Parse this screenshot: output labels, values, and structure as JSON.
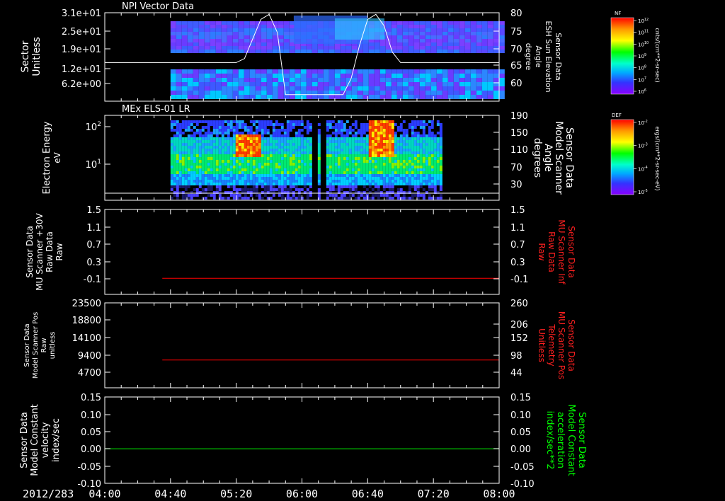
{
  "chart_data": [
    {
      "type": "heatmap",
      "title": "NPI Vector Data",
      "ylabel_left": [
        "Sector",
        "Unitless"
      ],
      "ylabel_right": [
        "Sensor Data",
        "ESH Sun Elevation",
        "Angle",
        "degree"
      ],
      "yticks_left": [
        "3.1e+01",
        "2.5e+01",
        "1.9e+01",
        "1.2e+01",
        "6.2e+00"
      ],
      "yticks_right": [
        "80",
        "75",
        "70",
        "65",
        "60"
      ],
      "ylim_right": [
        53,
        80
      ],
      "colorbar": {
        "label": "NF",
        "units": "cnts/(cm**2-sr-sec)",
        "ticks": [
          "10^12",
          "10^11",
          "10^10",
          "10^9",
          "10^8",
          "10^7",
          "10^6"
        ]
      },
      "overlay_line": {
        "name": "ESH Sun Elevation Angle",
        "color": "#ffffff",
        "x": [
          "04:00",
          "05:20",
          "05:25",
          "05:30",
          "05:35",
          "05:40",
          "05:45",
          "05:50",
          "06:25",
          "06:30",
          "06:35",
          "06:40",
          "06:45",
          "06:50",
          "06:55",
          "07:00",
          "08:00"
        ],
        "y": [
          64.8,
          64.8,
          66,
          72,
          78,
          79.5,
          74,
          55,
          55,
          60,
          70,
          78,
          79.5,
          76,
          68,
          64.8,
          64.8
        ]
      }
    },
    {
      "type": "heatmap",
      "title": "MEx ELS-01 LR",
      "ylabel_left": [
        "Electron Energy",
        "eV"
      ],
      "ylabel_right": [
        "Sensor Data",
        "Model Scanner",
        "Angle",
        "degrees"
      ],
      "yticks_left": [
        "10^2",
        "10^1"
      ],
      "yticks_right": [
        "190",
        "150",
        "110",
        "70",
        "30"
      ],
      "ylim_right": [
        0,
        190
      ],
      "colorbar": {
        "label": "DEF",
        "units": "ergs/(cm**2-sr-sec-eV)",
        "ticks": [
          "10^-2",
          "10^-3",
          "10^-4",
          "10^-5"
        ]
      },
      "overlay_line": {
        "name": "Model Scanner Angle",
        "color": "#ffffff",
        "x": [
          "04:00",
          "08:00"
        ],
        "y": [
          10,
          10
        ]
      }
    },
    {
      "type": "line",
      "ylabel_left": [
        "Sensor Data",
        "MU Scanner +30V",
        "Raw Data",
        "Raw"
      ],
      "ylabel_right": [
        "Sensor Data",
        "MU Scanner Inf",
        "Raw Data",
        "Raw"
      ],
      "yticks_left": [
        "1.5",
        "1.1",
        "0.7",
        "0.3",
        "-0.1"
      ],
      "yticks_right": [
        "1.5",
        "1.1",
        "0.7",
        "0.3",
        "-0.1"
      ],
      "ylim": [
        -0.35,
        1.5
      ],
      "series": [
        {
          "color": "#ff0000",
          "x": [
            "04:35",
            "08:00"
          ],
          "y": [
            0,
            0
          ]
        }
      ]
    },
    {
      "type": "line",
      "ylabel_left": [
        "Sensor Data",
        "Model Scanner Pos",
        "Raw",
        "unitless"
      ],
      "ylabel_right": [
        "Sensor Data",
        "MU Scanner Pos",
        "Telemetry",
        "Unitless"
      ],
      "yticks_left": [
        "23500",
        "18800",
        "14100",
        "9400",
        "4700"
      ],
      "yticks_right": [
        "260",
        "206",
        "152",
        "98",
        "44"
      ],
      "ylim_left": [
        0,
        23500
      ],
      "ylim_right": [
        0,
        260
      ],
      "series": [
        {
          "color": "#ff0000",
          "x": [
            "04:35",
            "08:00"
          ],
          "y": [
            85,
            85
          ]
        }
      ]
    },
    {
      "type": "line",
      "ylabel_left": [
        "Sensor Data",
        "Model Constant",
        "velocity",
        "index/sec"
      ],
      "ylabel_right": [
        "Sensor Data",
        "Model Constant",
        "acceleration",
        "index/sec**2"
      ],
      "yticks_left": [
        "0.15",
        "0.10",
        "0.05",
        "0.00",
        "-0.05",
        "-0.10"
      ],
      "yticks_right": [
        "0.15",
        "0.10",
        "0.05",
        "0.00",
        "-0.05",
        "-0.10"
      ],
      "ylim": [
        -0.1,
        0.15
      ],
      "series": [
        {
          "color": "#00ff00",
          "x": [
            "04:00",
            "08:00"
          ],
          "y": [
            0,
            0
          ]
        }
      ]
    }
  ],
  "xaxis": {
    "date_label": "2012/283",
    "ticks": [
      "04:00",
      "04:40",
      "05:20",
      "06:00",
      "06:40",
      "07:20",
      "08:00"
    ],
    "range": [
      "04:00",
      "08:00"
    ]
  },
  "colors": {
    "background": "#000000",
    "axes": "#ffffff",
    "red_series": "#ff0000",
    "green_series": "#00ff00"
  }
}
